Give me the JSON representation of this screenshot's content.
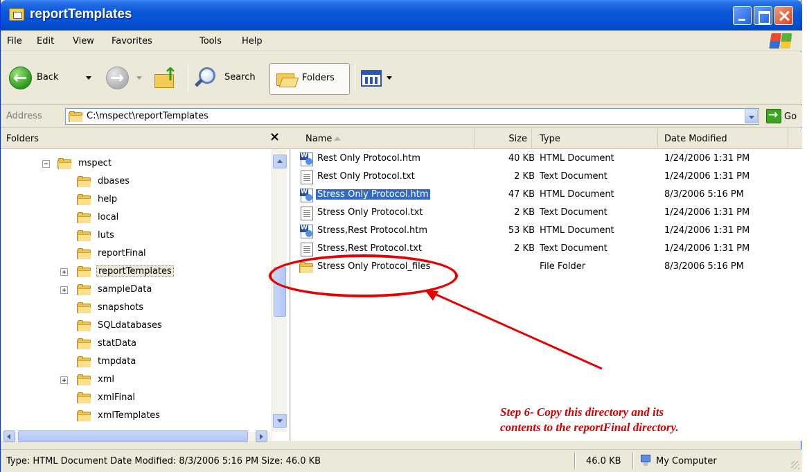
{
  "window": {
    "title": "reportTemplates"
  },
  "menu": [
    "File",
    "Edit",
    "View",
    "Favorites",
    "Tools",
    "Help"
  ],
  "toolbar": {
    "back_label": "Back",
    "search_label": "Search",
    "folders_label": "Folders"
  },
  "address": {
    "label": "Address",
    "value": "C:\\mspect\\reportTemplates",
    "go_label": "Go"
  },
  "folders_pane": {
    "title": "Folders",
    "close_glyph": "×",
    "items": [
      {
        "label": "mspect",
        "expander": "minus"
      },
      {
        "label": "dbases"
      },
      {
        "label": "help"
      },
      {
        "label": "local"
      },
      {
        "label": "luts"
      },
      {
        "label": "reportFinal"
      },
      {
        "label": "reportTemplates",
        "expander": "plus",
        "selected": true
      },
      {
        "label": "sampleData",
        "expander": "plus"
      },
      {
        "label": "snapshots"
      },
      {
        "label": "SQLdatabases"
      },
      {
        "label": "statData"
      },
      {
        "label": "tmpdata"
      },
      {
        "label": "xml",
        "expander": "plus"
      },
      {
        "label": "xmlFinal"
      },
      {
        "label": "xmlTemplates"
      }
    ]
  },
  "file_list": {
    "columns": {
      "name": "Name",
      "size": "Size",
      "type": "Type",
      "date": "Date Modified"
    },
    "rows": [
      {
        "name": "Rest Only Protocol.htm",
        "size": "40 KB",
        "type": "HTML Document",
        "date": "1/24/2006 1:31 PM",
        "icon": "htm-icon"
      },
      {
        "name": "Rest Only Protocol.txt",
        "size": "2 KB",
        "type": "Text Document",
        "date": "1/24/2006 1:31 PM",
        "icon": "txt-icon"
      },
      {
        "name": "Stress Only Protocol.htm",
        "size": "47 KB",
        "type": "HTML Document",
        "date": "8/3/2006 5:16 PM",
        "icon": "htm-icon",
        "selected": true
      },
      {
        "name": "Stress Only Protocol.txt",
        "size": "2 KB",
        "type": "Text Document",
        "date": "1/24/2006 1:31 PM",
        "icon": "txt-icon"
      },
      {
        "name": "Stress,Rest Protocol.htm",
        "size": "53 KB",
        "type": "HTML Document",
        "date": "1/24/2006 1:31 PM",
        "icon": "htm-icon"
      },
      {
        "name": "Stress,Rest Protocol.txt",
        "size": "2 KB",
        "type": "Text Document",
        "date": "1/24/2006 1:31 PM",
        "icon": "txt-icon"
      },
      {
        "name": "Stress Only Protocol_files",
        "size": "",
        "type": "File Folder",
        "date": "8/3/2006 5:16 PM",
        "icon": "folder-icon"
      }
    ]
  },
  "annotation": {
    "line1": "Step 6- Copy this directory and its",
    "line2": "contents to the reportFinal directory.",
    "color": "#e60000"
  },
  "statusbar": {
    "text": "Type: HTML Document Date Modified: 8/3/2006 5:16 PM Size: 46.0 KB",
    "size": "46.0 KB",
    "location": "My Computer"
  },
  "colors": {
    "title_bar": "#0a58d8",
    "selection": "#316ac5",
    "chrome": "#ece9d8"
  }
}
